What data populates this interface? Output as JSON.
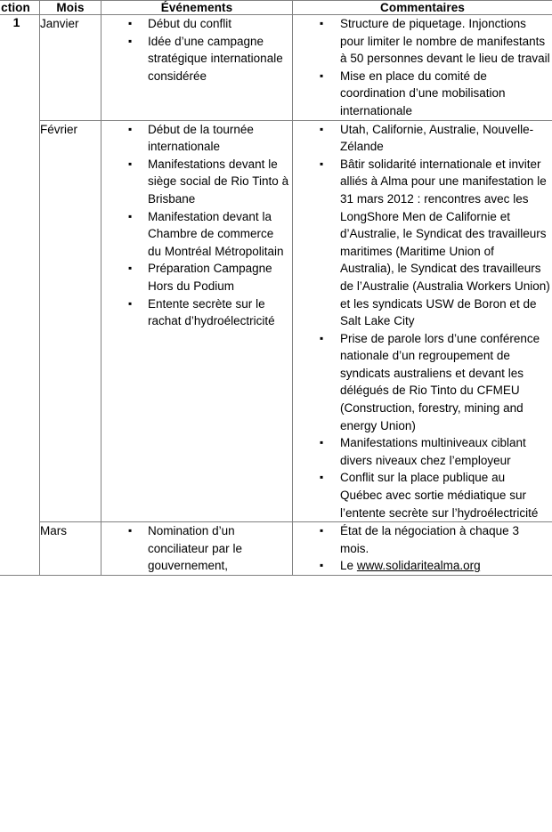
{
  "table": {
    "headers": {
      "action": "ction",
      "month": "Mois",
      "events": "Événements",
      "comments": "Commentaires"
    },
    "action_number": "1",
    "rows": [
      {
        "month": "Janvier",
        "events": [
          "Début du conflit",
          "Idée d’une campagne stratégique internationale considérée"
        ],
        "comments": [
          "Structure de piquetage. Injonctions pour limiter le nombre de manifestants à 50 personnes devant le lieu de travail",
          "Mise en place du comité de coordination d’une mobilisation internationale"
        ]
      },
      {
        "month": "Février",
        "events": [
          "Début de la tournée internationale",
          "Manifestations devant le siège social de Rio Tinto à Brisbane",
          "Manifestation devant la Chambre de commerce du Montréal Métropolitain",
          "Préparation Campagne Hors du Podium",
          "Entente secrète sur le rachat d’hydroélectricité"
        ],
        "comments": [
          "Utah, Californie, Australie, Nouvelle-Zélande",
          "Bâtir solidarité internationale et inviter alliés à Alma pour une manifestation le 31 mars 2012 : rencontres avec les LongShore Men de Californie et d’Australie, le Syndicat des travailleurs maritimes (Maritime Union of Australia), le Syndicat des travailleurs de l’Australie (Australia Workers Union) et les syndicats USW de Boron et de Salt Lake City",
          " Prise de parole lors d’une conférence nationale d’un regroupement de syndicats australiens et devant les délégués de Rio Tinto du CFMEU (Construction, forestry, mining and energy Union)",
          "Manifestations multiniveaux ciblant divers niveaux chez l’employeur",
          "Conflit sur la place publique au Québec avec sortie médiatique sur l’entente secrète sur l’hydroélectricité"
        ]
      },
      {
        "month": "Mars",
        "events": [
          "Nomination d’un conciliateur par le gouvernement,"
        ],
        "comments": [
          "État de la négociation à chaque 3 mois.",
          "Le www.solidaritealma.org"
        ],
        "comment_link": {
          "prefix": "Le ",
          "url_text": "www.solidaritealma.org"
        }
      }
    ]
  }
}
